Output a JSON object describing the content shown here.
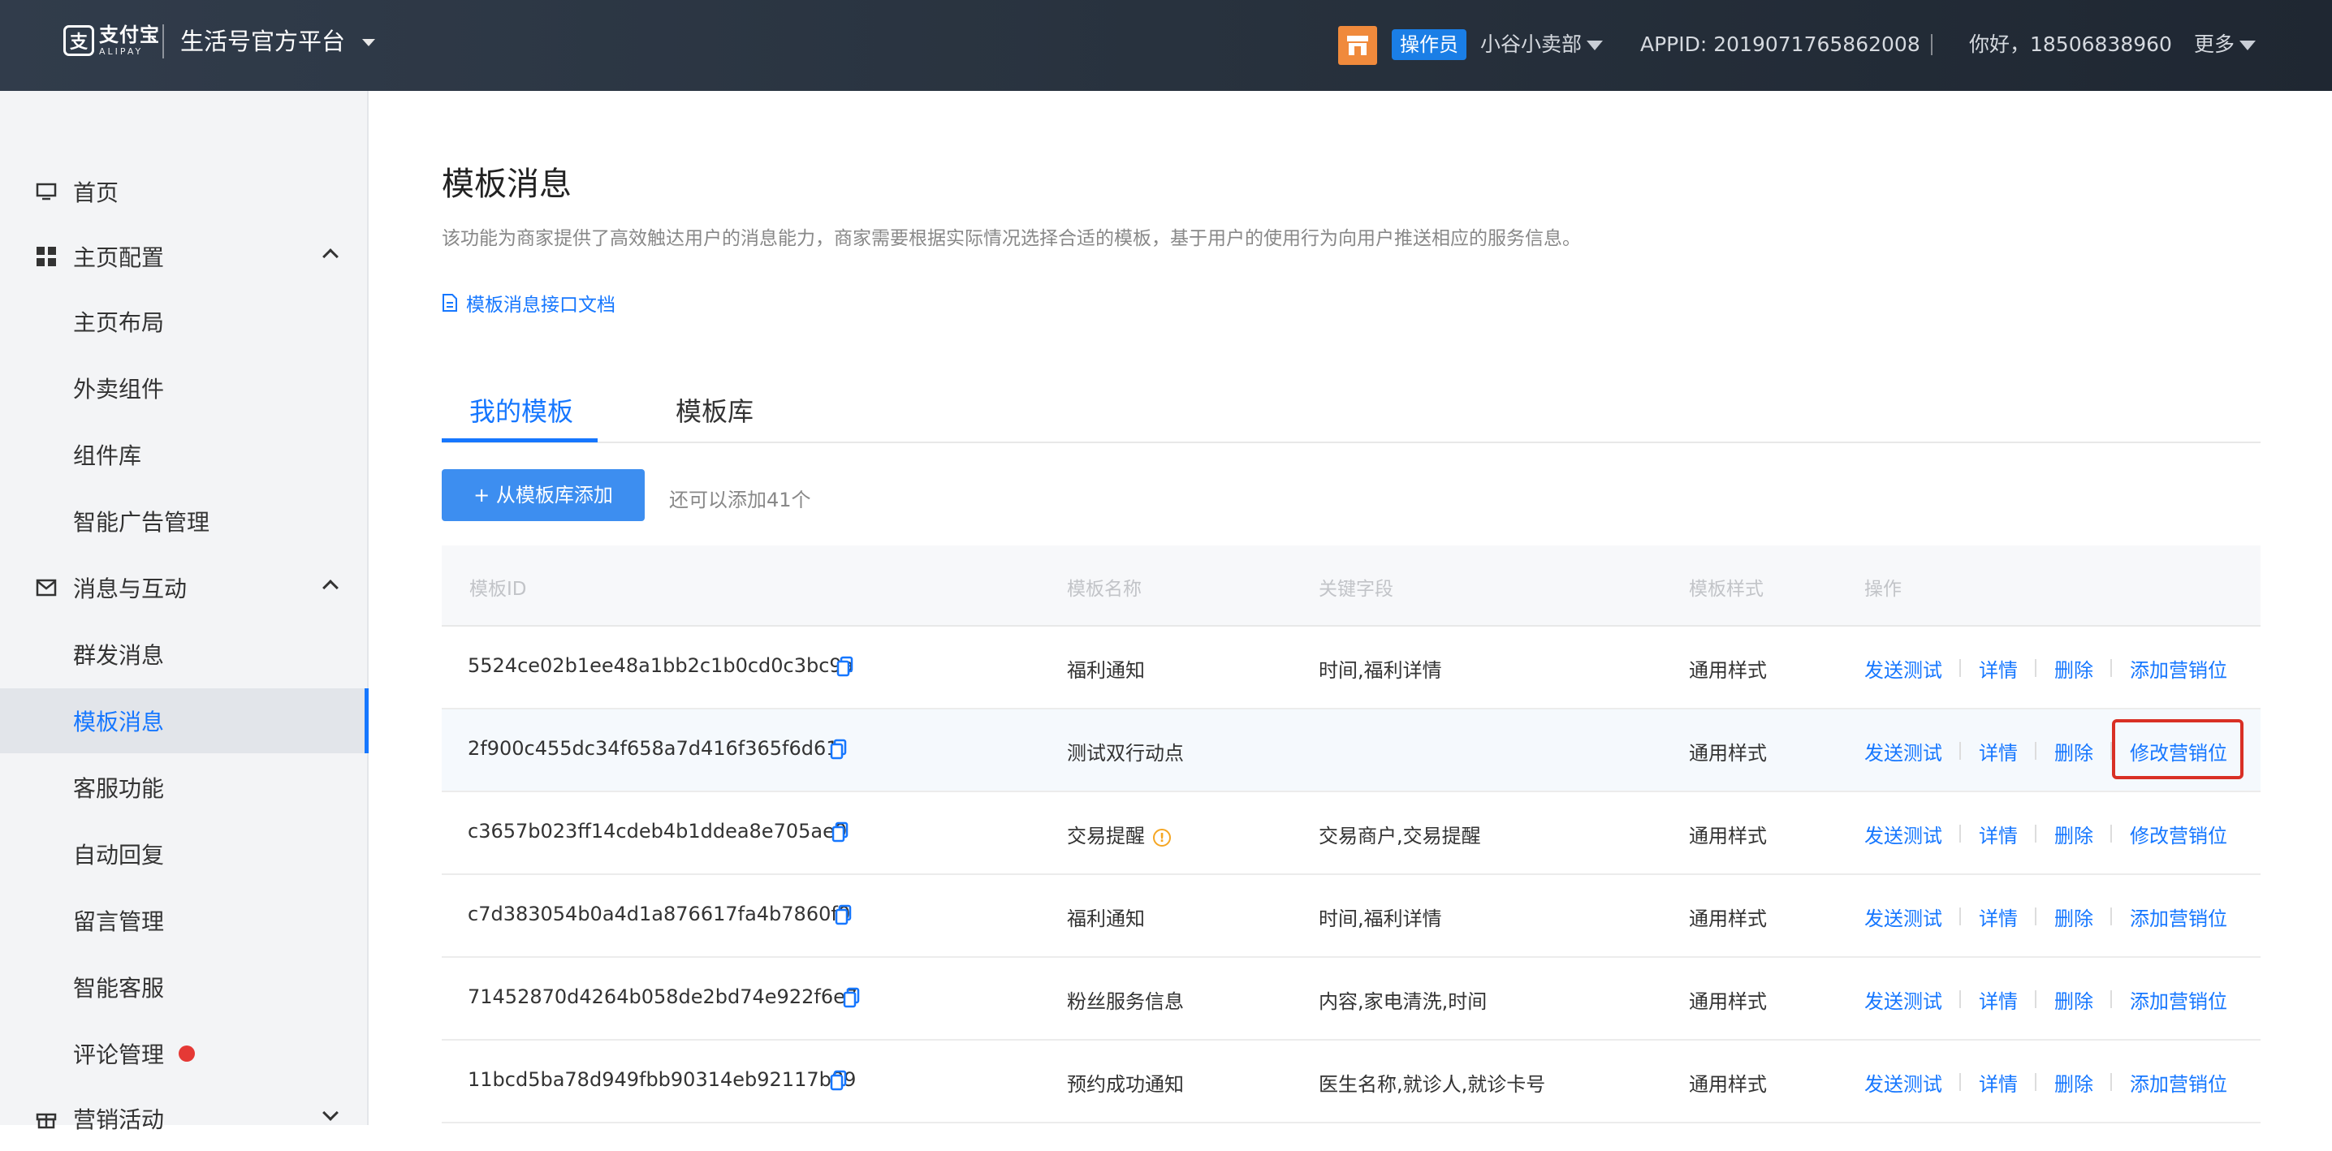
{
  "header": {
    "logo_cn": "支付宝",
    "logo_en": "ALIPAY",
    "platform_title": "生活号官方平台",
    "role_badge": "操作员",
    "shop_name": "小谷小卖部",
    "appid": "APPID: 2019071765862008",
    "greeting": "你好，18506838960",
    "more": "更多"
  },
  "sidebar": {
    "items": [
      {
        "label": "首页",
        "level": "top",
        "icon": "monitor-icon"
      },
      {
        "label": "主页配置",
        "level": "top",
        "icon": "grid-icon",
        "expanded": true
      },
      {
        "label": "主页布局",
        "level": "sub"
      },
      {
        "label": "外卖组件",
        "level": "sub"
      },
      {
        "label": "组件库",
        "level": "sub"
      },
      {
        "label": "智能广告管理",
        "level": "sub"
      },
      {
        "label": "消息与互动",
        "level": "top",
        "icon": "mail-icon",
        "expanded": true
      },
      {
        "label": "群发消息",
        "level": "sub"
      },
      {
        "label": "模板消息",
        "level": "sub",
        "active": true
      },
      {
        "label": "客服功能",
        "level": "sub"
      },
      {
        "label": "自动回复",
        "level": "sub"
      },
      {
        "label": "留言管理",
        "level": "sub"
      },
      {
        "label": "智能客服",
        "level": "sub"
      },
      {
        "label": "评论管理",
        "level": "sub",
        "badge": "red-dot"
      },
      {
        "label": "营销活动",
        "level": "top",
        "icon": "gift-icon",
        "expanded": false
      }
    ]
  },
  "main": {
    "title": "模板消息",
    "description": "该功能为商家提供了高效触达用户的消息能力，商家需要根据实际情况选择合适的模板，基于用户的使用行为向用户推送相应的服务信息。",
    "doc_link": "模板消息接口文档",
    "tabs": [
      {
        "label": "我的模板",
        "active": true
      },
      {
        "label": "模板库",
        "active": false
      }
    ],
    "add_button": "+ 从模板库添加",
    "add_hint": "还可以添加41个",
    "table": {
      "headers": [
        "模板ID",
        "模板名称",
        "关键字段",
        "模板样式",
        "操作"
      ],
      "rows": [
        {
          "id": "5524ce02b1ee48a1bb2c1b0cd0c3bc9a",
          "name": "福利通知",
          "fields": "时间,福利详情",
          "style": "通用样式",
          "ops": [
            "发送测试",
            "详情",
            "删除",
            "添加营销位"
          ]
        },
        {
          "id": "2f900c455dc34f658a7d416f365f6d61",
          "name": "测试双行动点",
          "fields": "",
          "style": "通用样式",
          "ops": [
            "发送测试",
            "详情",
            "删除",
            "修改营销位"
          ],
          "highlighted": true
        },
        {
          "id": "c3657b023ff14cdeb4b1ddea8e705ae9",
          "name": "交易提醒",
          "fields": "交易商户,交易提醒",
          "style": "通用样式",
          "ops": [
            "发送测试",
            "详情",
            "删除",
            "修改营销位"
          ],
          "warning": true
        },
        {
          "id": "c7d383054b0a4d1a876617fa4b7860f0",
          "name": "福利通知",
          "fields": "时间,福利详情",
          "style": "通用样式",
          "ops": [
            "发送测试",
            "详情",
            "删除",
            "添加营销位"
          ]
        },
        {
          "id": "71452870d4264b058de2bd74e922f6e7",
          "name": "粉丝服务信息",
          "fields": "内容,家电清洗,时间",
          "style": "通用样式",
          "ops": [
            "发送测试",
            "详情",
            "删除",
            "添加营销位"
          ]
        },
        {
          "id": "11bcd5ba78d949fbb90314eb92117b89",
          "name": "预约成功通知",
          "fields": "医生名称,就诊人,就诊卡号",
          "style": "通用样式",
          "ops": [
            "发送测试",
            "详情",
            "删除",
            "添加营销位"
          ]
        }
      ]
    }
  },
  "colors": {
    "accent": "#1677ff",
    "button": "#3d8ef0",
    "shop_icon": "#f08a3c",
    "highlight_box": "#d93025",
    "warning": "#f5a623"
  }
}
